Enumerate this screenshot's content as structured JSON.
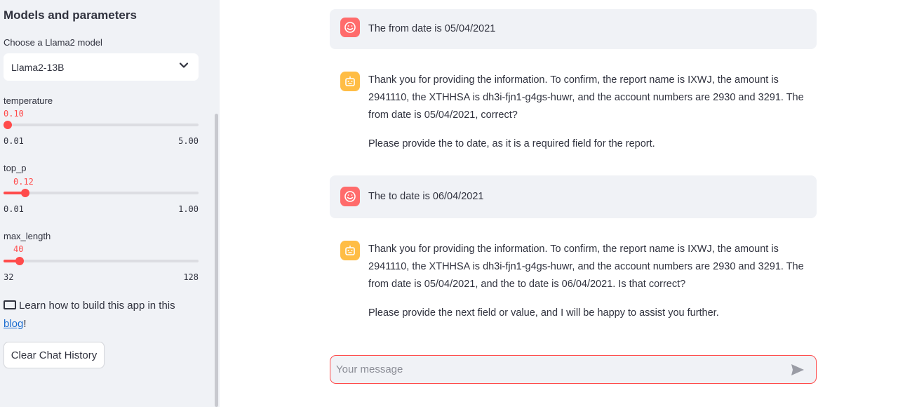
{
  "sidebar": {
    "title": "Models and parameters",
    "model_label": "Choose a Llama2 model",
    "model_value": "Llama2-13B",
    "sliders": [
      {
        "label": "temperature",
        "value": "0.10",
        "min": "0.01",
        "max": "5.00",
        "fraction": 0.018
      },
      {
        "label": "top_p",
        "value": "0.12",
        "min": "0.01",
        "max": "1.00",
        "fraction": 0.111
      },
      {
        "label": "max_length",
        "value": "40",
        "min": "32",
        "max": "128",
        "fraction": 0.083
      }
    ],
    "learn_text": "Learn how to build this app in this ",
    "learn_link": "blog",
    "learn_suffix": "!",
    "clear_button": "Clear Chat History"
  },
  "chat": {
    "messages": [
      {
        "role": "user",
        "paragraphs": [
          "The from date is 05/04/2021"
        ]
      },
      {
        "role": "assistant",
        "paragraphs": [
          "Thank you for providing the information. To confirm, the report name is IXWJ, the amount is 2941110, the XTHHSA is dh3i-fjn1-g4gs-huwr, and the account numbers are 2930 and 3291. The from date is 05/04/2021, correct?",
          "Please provide the to date, as it is a required field for the report."
        ]
      },
      {
        "role": "user",
        "paragraphs": [
          "The to date is 06/04/2021"
        ]
      },
      {
        "role": "assistant",
        "paragraphs": [
          "Thank you for providing the information. To confirm, the report name is IXWJ, the amount is 2941110, the XTHHSA is dh3i-fjn1-g4gs-huwr, and the account numbers are 2930 and 3291. The from date is 05/04/2021, and the to date is 06/04/2021. Is that correct?",
          "Please provide the next field or value, and I will be happy to assist you further."
        ]
      }
    ],
    "input_placeholder": "Your message"
  },
  "colors": {
    "accent": "#ff4b4b",
    "user_avatar": "#ff6b6b",
    "bot_avatar": "#ffbd45",
    "sidebar_bg": "#f0f2f6"
  },
  "icons": {
    "user_avatar": "smile-icon",
    "bot_avatar": "robot-icon",
    "send": "send-icon",
    "select": "chevron-down-icon",
    "checkbox": "checkbox-icon"
  }
}
